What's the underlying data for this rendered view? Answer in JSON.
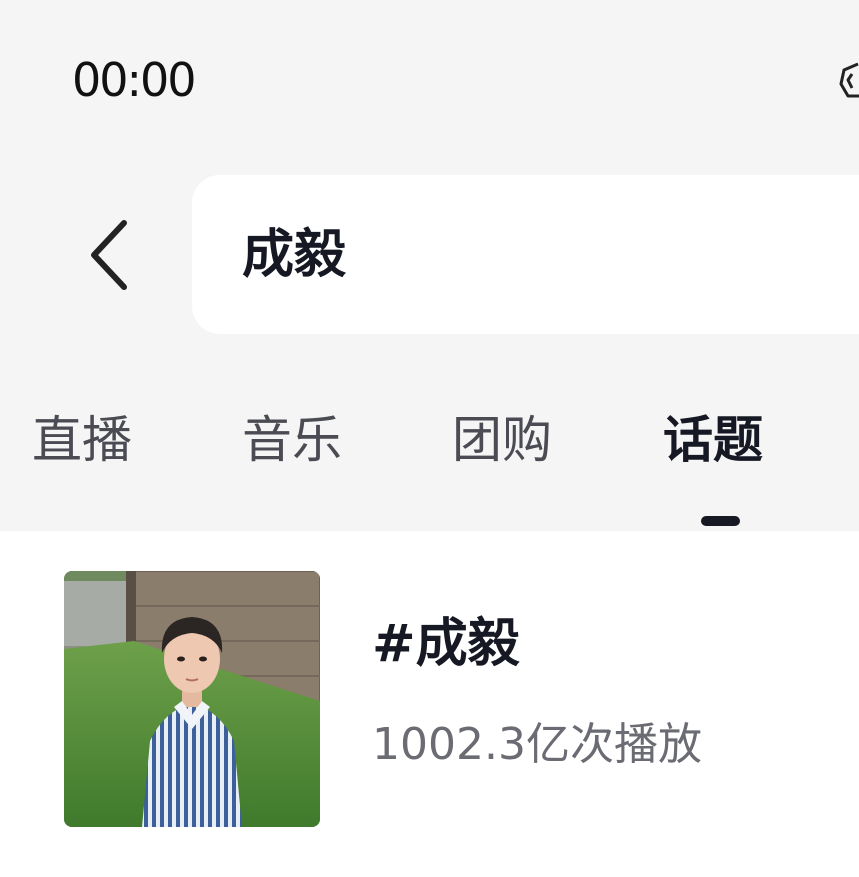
{
  "status_bar": {
    "time": "00:00"
  },
  "search": {
    "query": "成毅"
  },
  "tabs": [
    {
      "label": "直播",
      "active": false
    },
    {
      "label": "音乐",
      "active": false
    },
    {
      "label": "团购",
      "active": false
    },
    {
      "label": "话题",
      "active": true
    }
  ],
  "results": [
    {
      "title": "#成毅",
      "views": "1002.3亿次播放"
    }
  ],
  "colors": {
    "text_primary": "#161823",
    "text_secondary": "#6b6c73",
    "background": "#f5f5f5"
  }
}
